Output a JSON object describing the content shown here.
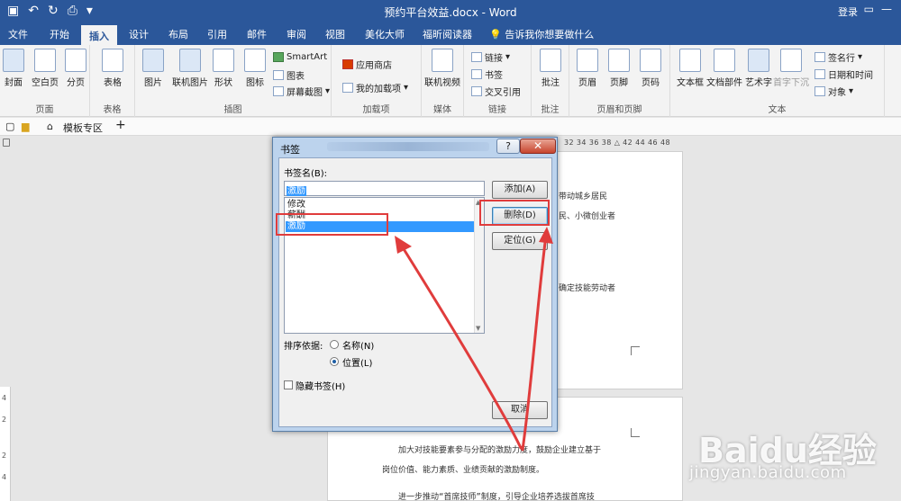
{
  "window": {
    "title": "预约平台效益.docx - Word",
    "login": "登录"
  },
  "tabs": [
    "文件",
    "开始",
    "插入",
    "设计",
    "布局",
    "引用",
    "邮件",
    "审阅",
    "视图",
    "美化大师",
    "福昕阅读器"
  ],
  "active_tab": "插入",
  "tell_me": "告诉我你想要做什么",
  "ribbon": {
    "pages": {
      "buttons": [
        "封面",
        "空白页",
        "分页"
      ],
      "label": "页面"
    },
    "tables": {
      "buttons": [
        "表格"
      ],
      "label": "表格"
    },
    "illustrations": {
      "buttons": [
        "图片",
        "联机图片",
        "形状",
        "图标"
      ],
      "small": [
        "SmartArt",
        "图表",
        "屏幕截图"
      ],
      "label": "插图"
    },
    "addins": {
      "small": [
        "应用商店",
        "我的加载项"
      ],
      "label": "加载项"
    },
    "media": {
      "buttons": [
        "联机视频"
      ],
      "label": "媒体"
    },
    "links": {
      "small": [
        "链接",
        "书签",
        "交叉引用"
      ],
      "label": "链接"
    },
    "comments": {
      "buttons": [
        "批注"
      ],
      "label": "批注"
    },
    "header_footer": {
      "buttons": [
        "页眉",
        "页脚",
        "页码"
      ],
      "label": "页眉和页脚"
    },
    "text": {
      "buttons": [
        "文本框",
        "文档部件",
        "艺术字",
        "首字下沉"
      ],
      "small": [
        "签名行",
        "日期和时间",
        "对象"
      ],
      "label": "文本"
    }
  },
  "doc_tabs": {
    "template_zone": "模板专区",
    "add": "+"
  },
  "ruler": {
    "numbers": "32 34 36 38 △ 42 44 46 48"
  },
  "dialog": {
    "title": "书签",
    "help": "?",
    "close": "✕",
    "name_label": "书签名(B):",
    "name_value": "激励",
    "list": [
      "修改",
      "薪酬",
      "激励"
    ],
    "selected_item": "激励",
    "buttons": {
      "add": "添加(A)",
      "delete": "删除(D)",
      "goto": "定位(G)",
      "cancel": "取消"
    },
    "sort_label": "排序依据:",
    "sort_options": [
      "名称(N)",
      "位置(L)"
    ],
    "sort_selected": "位置(L)",
    "hidden_label": "隐藏书签(H)"
  },
  "document": {
    "page1_lines": [
      "带动城乡居民",
      "民、小微创业者",
      "确定技能劳动者"
    ],
    "page2_lines": [
      "加大对技能要素参与分配的激励力度，鼓励企业建立基于",
      "岗位价值、能力素质、业绩贡献的激励制度。",
      "进一步推动“首席技师”制度，引导企业培养选拔首席技"
    ]
  },
  "vruler": [
    "4",
    "2",
    "2",
    "4"
  ],
  "watermark": {
    "logo": "Baidu经验",
    "url": "jingyan.baidu.com"
  },
  "colors": {
    "word_blue": "#2b579a",
    "highlight_red": "#e03c3c",
    "selection": "#3399ff"
  }
}
